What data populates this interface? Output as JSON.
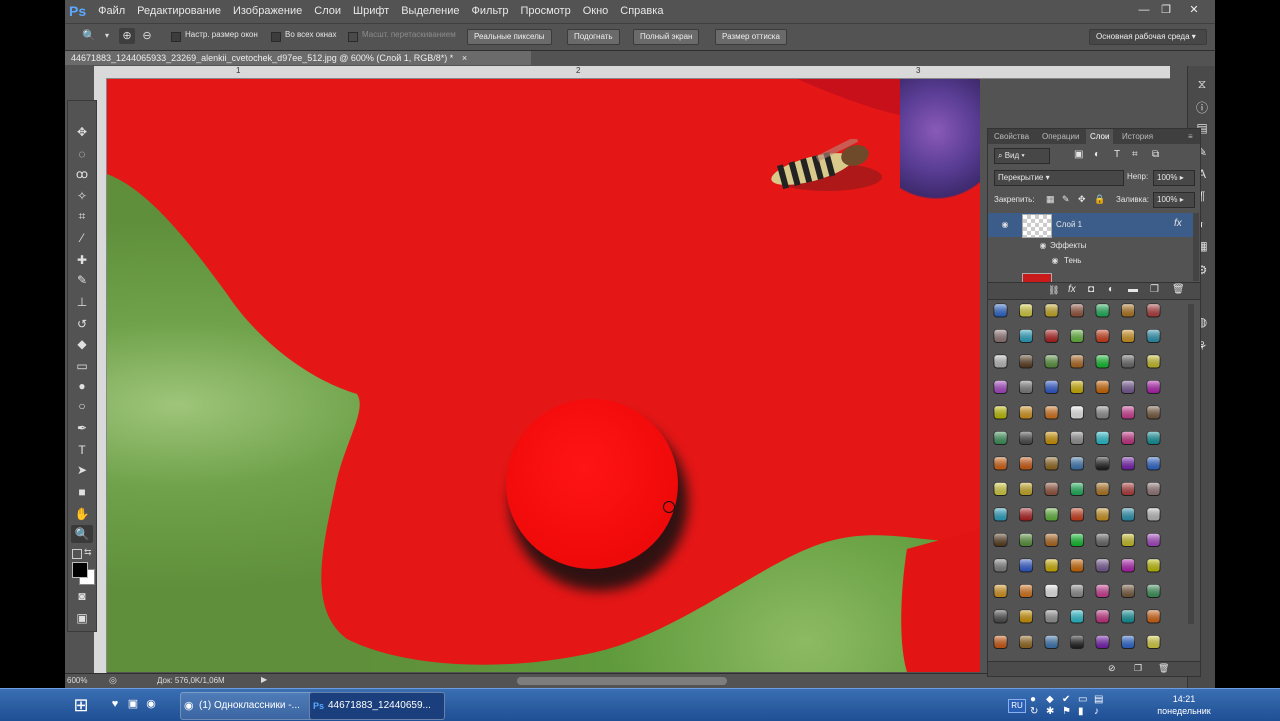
{
  "app": {
    "logo": "Ps",
    "menu": [
      "Файл",
      "Редактирование",
      "Изображение",
      "Слои",
      "Шрифт",
      "Выделение",
      "Фильтр",
      "Просмотр",
      "Окно",
      "Справка"
    ],
    "window_controls": {
      "minimize": "—",
      "restore": "❐",
      "close": "✕"
    }
  },
  "options_bar": {
    "resize_windows": "Настр. размер окон",
    "all_windows": "Во всех окнах",
    "scrubby_zoom": "Масшт. перетаскиванием",
    "actual_pixels": "Реальные пикселы",
    "fit_screen": "Подогнать",
    "fill_screen": "Полный экран",
    "print_size": "Размер оттиска",
    "workspace": "Основная рабочая среда"
  },
  "document": {
    "tab_title": "44671883_1244065933_23269_alenkii_cvetochek_d97ee_512.jpg @ 600% (Слой 1, RGB/8*) *",
    "tab_close": "×",
    "ruler_marks": [
      "1",
      "2",
      "3"
    ]
  },
  "status": {
    "zoom": "600%",
    "doc_size": "Док: 576,0K/1,06M"
  },
  "layers_panel": {
    "tabs": [
      "Свойства",
      "Операции",
      "Слои",
      "История"
    ],
    "active_tab": "Слои",
    "filter_kind": "Вид",
    "blend_mode": "Перекрытие",
    "opacity_label": "Непр:",
    "opacity_value": "100%",
    "lock_label": "Закрепить:",
    "fill_label": "Заливка:",
    "fill_value": "100%",
    "layer_name": "Слой 1",
    "fx_badge": "fx",
    "effects_label": "Эффекты",
    "shadow_label": "Тень",
    "footer_fx": "fx"
  },
  "taskbar": {
    "task1": "(1) Одноклассники -...",
    "task2": "44671883_12440659...",
    "lang": "RU",
    "time": "14:21",
    "day": "понедельник"
  },
  "colors": {
    "ui_bg": "#535353",
    "petal": "#e51616",
    "drop": "#f20b0b",
    "layer_selected": "#3c5c8a",
    "taskbar": "#1f4f94"
  }
}
